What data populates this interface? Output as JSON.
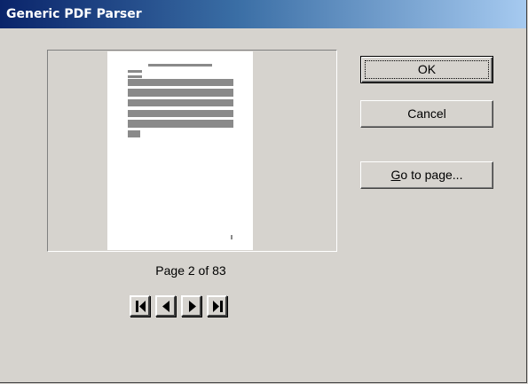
{
  "window": {
    "title": "Generic PDF Parser"
  },
  "preview": {
    "page_label": "Page 2 of 83",
    "current_page": 2,
    "total_pages": 83
  },
  "navigation": {
    "first_icon": "first-page-icon",
    "prev_icon": "previous-page-icon",
    "next_icon": "next-page-icon",
    "last_icon": "last-page-icon"
  },
  "buttons": {
    "ok_label": "OK",
    "cancel_label": "Cancel",
    "goto_accel": "G",
    "goto_rest": "o to page..."
  },
  "colors": {
    "titlebar_start": "#0a246a",
    "titlebar_end": "#a6caf0",
    "dialog_face": "#d6d3ce",
    "page_white": "#ffffff",
    "text_placeholder": "#8a8a8a"
  }
}
